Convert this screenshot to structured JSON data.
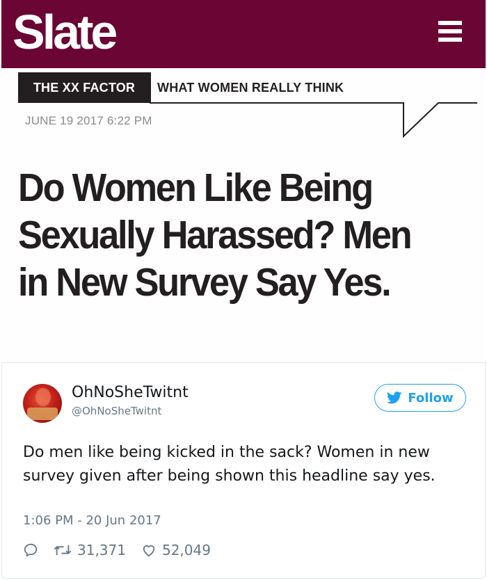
{
  "article": {
    "logo": "Slate",
    "section_tag": "THE XX FACTOR",
    "section_subtitle": "WHAT WOMEN REALLY THINK",
    "date": "JUNE 19 2017 6:22 PM",
    "headline": "Do Women Like Being Sexually Harassed? Men in New Survey Say Yes.",
    "brand_color": "#6b0533"
  },
  "tweet": {
    "display_name": "OhNoSheTwitnt",
    "handle": "@OhNoSheTwitnt",
    "follow_label": "Follow",
    "text": "Do men like being kicked in the sack? Women in new survey given after being shown this headline say yes.",
    "timestamp": "1:06 PM - 20 Jun 2017",
    "retweets": "31,371",
    "likes": "52,049",
    "accent_color": "#1da1f2",
    "icons": [
      "reply-icon",
      "retweet-icon",
      "heart-icon",
      "twitter-bird-icon"
    ]
  }
}
